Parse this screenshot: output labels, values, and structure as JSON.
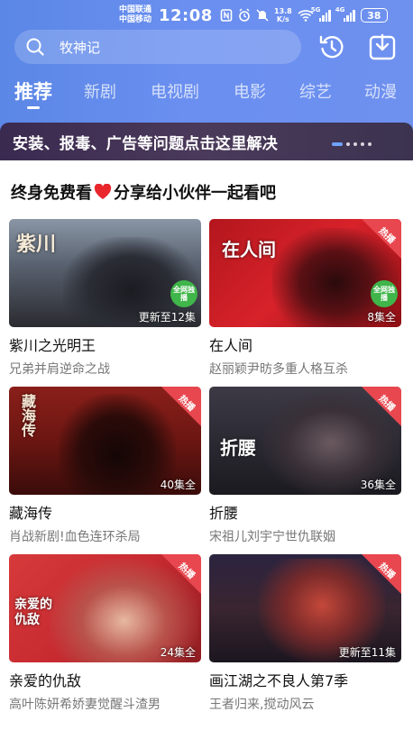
{
  "status_bar": {
    "carrier1": "中国联通",
    "carrier2": "中国移动",
    "time": "12:08",
    "speed_value": "13.8",
    "speed_unit": "K/s",
    "wifi_tag": "5G",
    "cell_tag": "4G",
    "battery": "38"
  },
  "search": {
    "text": "牧神记"
  },
  "tabs": [
    {
      "label": "推荐",
      "active": true
    },
    {
      "label": "新剧"
    },
    {
      "label": "电视剧"
    },
    {
      "label": "电影"
    },
    {
      "label": "综艺"
    },
    {
      "label": "动漫"
    }
  ],
  "banner": {
    "text": "安装、报毒、广告等问题点击这里解决"
  },
  "section": {
    "title_left": "终身免费看",
    "title_right": "分享给小伙伴一起看吧"
  },
  "cards": [
    {
      "title": "紫川之光明王",
      "subtitle": "兄弟并肩逆命之战",
      "episodes": "更新至12集",
      "poster_text": "紫川",
      "badge": "全网独播",
      "hot": false
    },
    {
      "title": "在人间",
      "subtitle": "赵丽颖尹昉多重人格互杀",
      "episodes": "8集全",
      "poster_text": "在人间",
      "badge": "全网独播",
      "hot": true,
      "hot_label": "热播"
    },
    {
      "title": "藏海传",
      "subtitle": "肖战新剧!血色连环杀局",
      "episodes": "40集全",
      "poster_text": "藏海传",
      "hot": true,
      "hot_label": "热播"
    },
    {
      "title": "折腰",
      "subtitle": "宋祖儿刘宇宁世仇联姻",
      "episodes": "36集全",
      "poster_text": "折腰",
      "hot": true,
      "hot_label": "热播"
    },
    {
      "title": "亲爱的仇敌",
      "subtitle": "高叶陈妍希娇妻觉醒斗渣男",
      "episodes": "24集全",
      "poster_text": "亲爱的仇敌",
      "hot": true,
      "hot_label": "热播"
    },
    {
      "title": "画江湖之不良人第7季",
      "subtitle": "王者归来,搅动风云",
      "episodes": "更新至11集",
      "poster_text": "",
      "hot": true,
      "hot_label": "热播"
    }
  ],
  "colors": {
    "header": "#6a8ff0",
    "hot": "#ea4a52",
    "badge": "#3fb54a"
  }
}
